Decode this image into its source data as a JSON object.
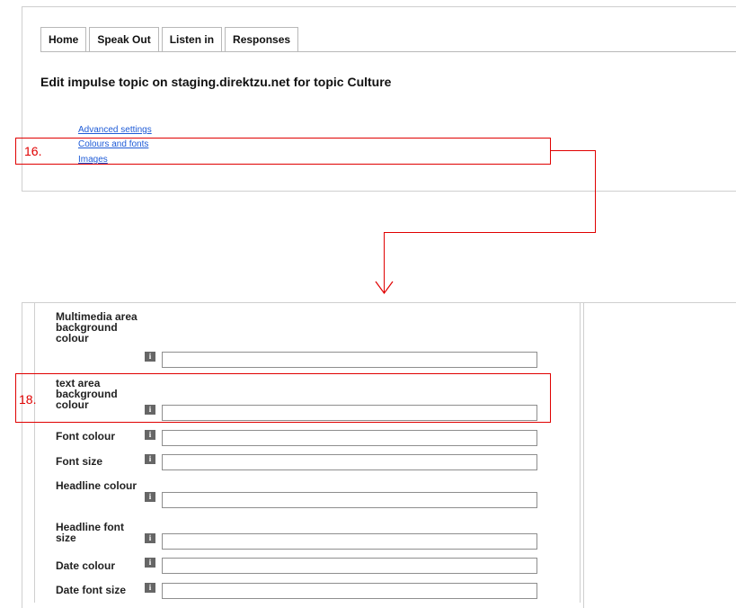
{
  "tabs": [
    "Home",
    "Speak Out",
    "Listen in",
    "Responses"
  ],
  "page_title": "Edit impulse topic on staging.direktzu.net for topic Culture",
  "links": {
    "advanced": "Advanced settings",
    "colours": "Colours and fonts",
    "images": "Images"
  },
  "annotations": {
    "step16": "16.",
    "step18": "18.",
    "color": "#e00000"
  },
  "info_glyph": "i",
  "fields": {
    "multimedia": {
      "label": "Multimedia area background colour",
      "value": ""
    },
    "textarea_bg": {
      "label": "text area background colour",
      "value": ""
    },
    "font_colour": {
      "label": "Font colour",
      "value": ""
    },
    "font_size": {
      "label": "Font size",
      "value": ""
    },
    "headline_colour": {
      "label": "Headline colour",
      "value": ""
    },
    "headline_font_size": {
      "label": "Headline font size",
      "value": ""
    },
    "date_colour": {
      "label": "Date colour",
      "value": ""
    },
    "date_font_size": {
      "label": "Date font size",
      "value": ""
    }
  }
}
